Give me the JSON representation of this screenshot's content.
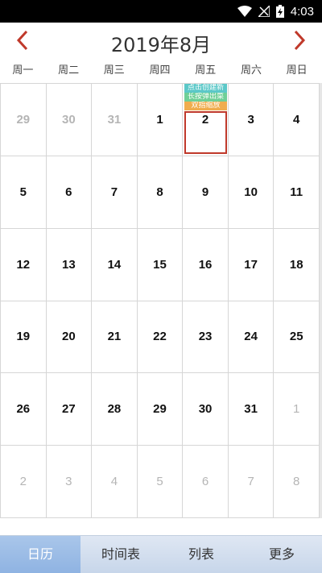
{
  "status_bar": {
    "time": "4:03"
  },
  "header": {
    "title": "2019年8月"
  },
  "weekdays": [
    "周一",
    "周二",
    "周三",
    "周四",
    "周五",
    "周六",
    "周日"
  ],
  "hints": [
    "点击创建新",
    "长按弹出菜",
    "双指缩放"
  ],
  "calendar": {
    "rows": [
      [
        "29",
        "30",
        "31",
        "1",
        "2",
        "3",
        "4"
      ],
      [
        "5",
        "6",
        "7",
        "8",
        "9",
        "10",
        "11"
      ],
      [
        "12",
        "13",
        "14",
        "15",
        "16",
        "17",
        "18"
      ],
      [
        "19",
        "20",
        "21",
        "22",
        "23",
        "24",
        "25"
      ],
      [
        "26",
        "27",
        "28",
        "29",
        "30",
        "31",
        "1"
      ],
      [
        "2",
        "3",
        "4",
        "5",
        "6",
        "7",
        "8"
      ]
    ],
    "selected_day": "2"
  },
  "tabs": [
    {
      "label": "日历"
    },
    {
      "label": "时间表"
    },
    {
      "label": "列表"
    },
    {
      "label": "更多"
    }
  ],
  "colors": {
    "accent": "#c0392b",
    "tab_active": "#9dbde6"
  }
}
